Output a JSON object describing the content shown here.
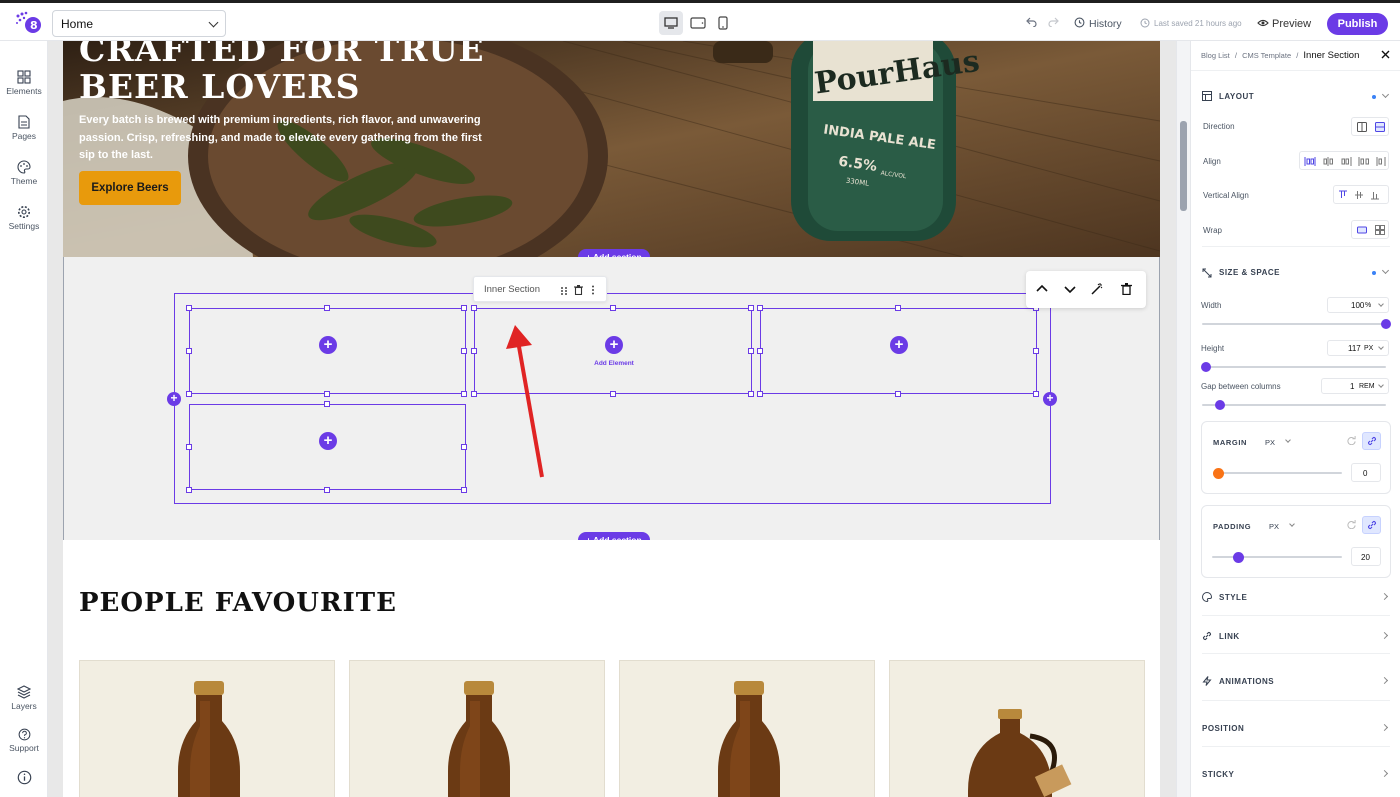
{
  "topbar": {
    "page_select": "Home",
    "history": "History",
    "last_saved": "Last saved 21 hours ago",
    "preview": "Preview",
    "publish": "Publish"
  },
  "leftnav": [
    {
      "label": "Elements",
      "icon": "grid-icon"
    },
    {
      "label": "Pages",
      "icon": "page-icon"
    },
    {
      "label": "Theme",
      "icon": "palette-icon"
    },
    {
      "label": "Settings",
      "icon": "gear-icon"
    },
    {
      "label": "Layers",
      "icon": "layers-icon"
    },
    {
      "label": "Support",
      "icon": "help-icon"
    },
    {
      "label": "",
      "icon": "info-icon"
    }
  ],
  "hero": {
    "title_line1": "CRAFTED FOR TRUE",
    "title_line2": "BEER LOVERS",
    "description": "Every batch is brewed with premium ingredients, rich flavor, and unwavering passion. Crisp, refreshing, and made to elevate every gathering from the first sip to the last.",
    "cta": "Explore Beers",
    "bottle_brand": "PourHaus",
    "bottle_type": "INDIA PALE ALE",
    "bottle_abv": "6.5%",
    "bottle_abv_unit": "ALC/VOL",
    "bottle_volume": "330ML"
  },
  "canvas": {
    "add_section": "+ Add section",
    "inner_section_label": "Inner Section",
    "add_element": "Add Element",
    "people_title": "PEOPLE FAVOURITE"
  },
  "panel": {
    "breadcrumb": [
      "Blog List",
      "CMS Template",
      "Inner Section"
    ],
    "layout": {
      "title": "LAYOUT",
      "direction": "Direction",
      "align": "Align",
      "vertical_align": "Vertical Align",
      "wrap": "Wrap"
    },
    "size": {
      "title": "SIZE & SPACE",
      "width_label": "Width",
      "width_value": "100",
      "width_unit": "%",
      "width_level": 1.0,
      "height_label": "Height",
      "height_value": "117",
      "height_unit": "PX",
      "height_level": 0.02,
      "gap_label": "Gap between columns",
      "gap_value": "1",
      "gap_unit": "REM",
      "gap_level": 0.1
    },
    "margin": {
      "label": "MARGIN",
      "unit": "PX",
      "value": "0",
      "level": 0.0
    },
    "padding": {
      "label": "PADDING",
      "unit": "PX",
      "value": "20",
      "level": 0.2
    },
    "sections": [
      "STYLE",
      "LINK",
      "ANIMATIONS",
      "POSITION",
      "STICKY"
    ]
  },
  "colors": {
    "accent": "#6b3be6",
    "cta": "#e89a0c",
    "arrow": "#e02424"
  }
}
